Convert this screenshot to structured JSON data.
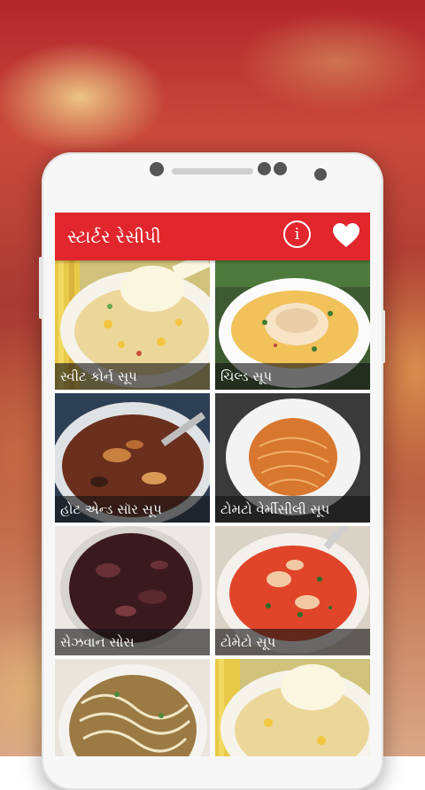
{
  "app": {
    "title": "સ્ટાર્ટર રેસીપી",
    "info_icon": "info-icon",
    "favorite_icon": "heart-icon",
    "accent_color": "#e1262d"
  },
  "recipes": [
    {
      "name": "સ્વીટ કોર્ન સૂપ",
      "image": "sweet-corn-soup"
    },
    {
      "name": "ચિલ્ડ સૂપ",
      "image": "chilled-soup"
    },
    {
      "name": "હોટ એન્ડ સૉર સૂપ",
      "image": "hot-and-sour-soup"
    },
    {
      "name": "ટોમટો વેર્મીસીલી સૂપ",
      "image": "tomato-vermicelli-soup"
    },
    {
      "name": "સેઝવાન સોસ",
      "image": "schezwan-sauce"
    },
    {
      "name": "ટોમેટો સૂપ",
      "image": "tomato-soup"
    },
    {
      "name": "",
      "image": "noodle-soup"
    },
    {
      "name": "",
      "image": "sweet-corn-soup"
    }
  ]
}
